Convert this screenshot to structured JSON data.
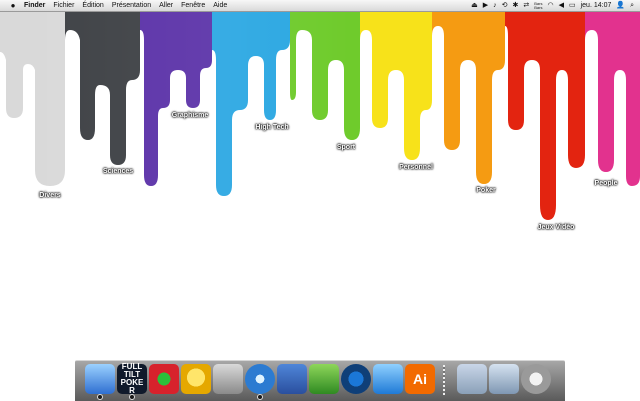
{
  "menubar": {
    "app_name": "Finder",
    "menus": [
      "Fichier",
      "Édition",
      "Présentation",
      "Aller",
      "Fenêtre",
      "Aide"
    ],
    "date_time": "jeu. 14:07",
    "status_tiny_text": "Bars\nBars"
  },
  "desktop": {
    "colors": {
      "gray": "#d9d9d9",
      "dark": "#3f4246",
      "purple": "#5b32a8",
      "cyan": "#2aa7e2",
      "lime": "#6fcb2c",
      "yellow": "#f7e21a",
      "orange": "#f59b12",
      "red": "#e32410",
      "pink": "#e2328e"
    },
    "labels": {
      "divers": "Divers",
      "sciences": "Sciences",
      "graphisme": "Graphisme",
      "high_tech": "High Tech",
      "sport": "Sport",
      "personnel": "Personnel",
      "poker": "Poker",
      "jeux_video": "Jeux Vidéo",
      "people": "People"
    }
  },
  "dock": {
    "fulltilt_text": "FULL TILT POKER",
    "illustrator_text": "Ai"
  }
}
